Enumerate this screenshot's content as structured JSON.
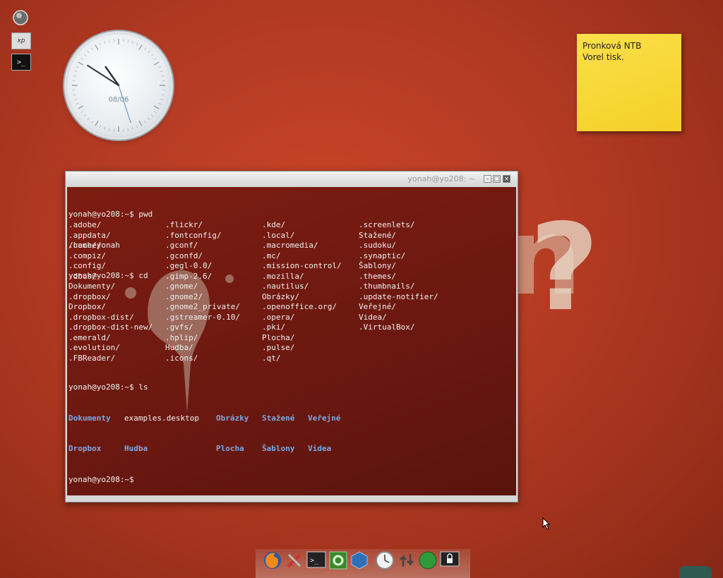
{
  "desktop": {
    "icons": [
      {
        "name": "globe-icon"
      },
      {
        "name": "windows-xp-icon",
        "label": "xp"
      },
      {
        "name": "terminal-launcher-icon",
        "label": ">_"
      }
    ]
  },
  "clock_widget": {
    "date": "08/06",
    "time": {
      "hour": 10,
      "minute": 50,
      "second": 27
    }
  },
  "sticky_note": {
    "lines": [
      "Pronková NTB",
      "Vorel tisk."
    ]
  },
  "terminal": {
    "title": "yonah@yo208: ~",
    "lines": [
      "yonah@yo208:~$ pwd",
      "/home/yonah",
      "yonah@yo208:~$ cd"
    ],
    "columns": [
      [
        ".adobe/",
        ".flickr/",
        ".kde/",
        ".screenlets/"
      ],
      [
        ".appdata/",
        ".fontconfig/",
        ".local/",
        "Stažené/"
      ],
      [
        ".cache/",
        ".gconf/",
        ".macromedia/",
        ".sudoku/"
      ],
      [
        ".compiz/",
        ".gconfd/",
        ".mc/",
        ".synaptic/"
      ],
      [
        ".config/",
        ".gegl-0.0/",
        ".mission-control/",
        "Šablony/"
      ],
      [
        ".dbus/",
        ".gimp-2.6/",
        ".mozilla/",
        ".themes/"
      ],
      [
        "Dokumenty/",
        ".gnome/",
        ".nautilus/",
        ".thumbnails/"
      ],
      [
        ".dropbox/",
        ".gnome2/",
        "Obrázky/",
        ".update-notifier/"
      ],
      [
        "Dropbox/",
        ".gnome2_private/",
        ".openoffice.org/",
        "Veřejné/"
      ],
      [
        ".dropbox-dist/",
        ".gstreamer-0.10/",
        ".opera/",
        "Videa/"
      ],
      [
        ".dropbox-dist-new/",
        ".gvfs/",
        ".pki/",
        ".VirtualBox/"
      ],
      [
        ".emerald/",
        ".hplip/",
        "Plocha/",
        ""
      ],
      [
        ".evolution/",
        "Hudba/",
        ".pulse/",
        ""
      ],
      [
        ".FBReader/",
        ".icons/",
        ".qt/",
        ""
      ]
    ],
    "ls_prompt": "yonah@yo208:~$ ls",
    "ls_row1": [
      {
        "text": "Dokumenty",
        "dir": true
      },
      {
        "text": "examples.desktop",
        "dir": false
      },
      {
        "text": "Obrázky",
        "dir": true
      },
      {
        "text": "Stažené",
        "dir": true
      },
      {
        "text": "Veřejné",
        "dir": true
      }
    ],
    "ls_row2": [
      {
        "text": "Dropbox",
        "dir": true
      },
      {
        "text": "Hudba",
        "dir": true
      },
      {
        "text": "",
        "dir": false
      },
      {
        "text": "Plocha",
        "dir": true
      },
      {
        "text": "Šablony",
        "dir": true
      },
      {
        "text": "Videa",
        "dir": true
      }
    ],
    "final_prompt": "yonah@yo208:~$"
  },
  "wallpaper": {
    "word": "design",
    "mark": "?"
  },
  "dock": {
    "items": [
      {
        "name": "firefox-icon"
      },
      {
        "name": "tools-icon"
      },
      {
        "name": "terminal-icon"
      },
      {
        "name": "settings-icon"
      },
      {
        "name": "virtualbox-icon"
      },
      {
        "name": "clock-icon"
      },
      {
        "name": "network-icon"
      },
      {
        "name": "green-orb-icon"
      },
      {
        "name": "lock-screen-icon"
      }
    ]
  },
  "colors": {
    "desktop_bg": "#b33a22",
    "terminal_bg": "#6a1810",
    "directory_text": "#7ba7e6",
    "note_yellow": "#f4cf27"
  }
}
